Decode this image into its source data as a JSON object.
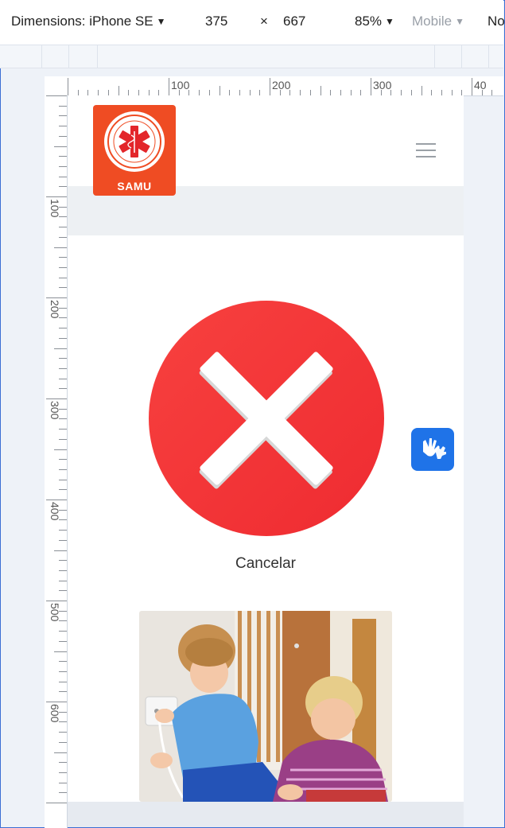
{
  "toolbar": {
    "dimensions_label": "Dimensions: iPhone SE",
    "width_value": "375",
    "times_symbol": "×",
    "height_value": "667",
    "zoom_value": "85%",
    "device_type": "Mobile",
    "throttle_partial": "No"
  },
  "ruler": {
    "top_labels": [
      "100",
      "200",
      "300",
      "40"
    ],
    "left_labels": [
      "100",
      "200",
      "300",
      "400",
      "500",
      "600"
    ]
  },
  "page": {
    "logo_text": "SAMU",
    "menu_icon": "hamburger-icon",
    "cancel_label": "Cancelar",
    "cancel_icon": "close-circle-icon",
    "accessibility_icon": "sign-language-hands-icon",
    "photo_subject": "children-near-electrical-outlet-photo"
  },
  "colors": {
    "logo_bg": "#ef4c23",
    "cancel_red": "#f4333a",
    "vlibras_blue": "#1f73e8"
  }
}
